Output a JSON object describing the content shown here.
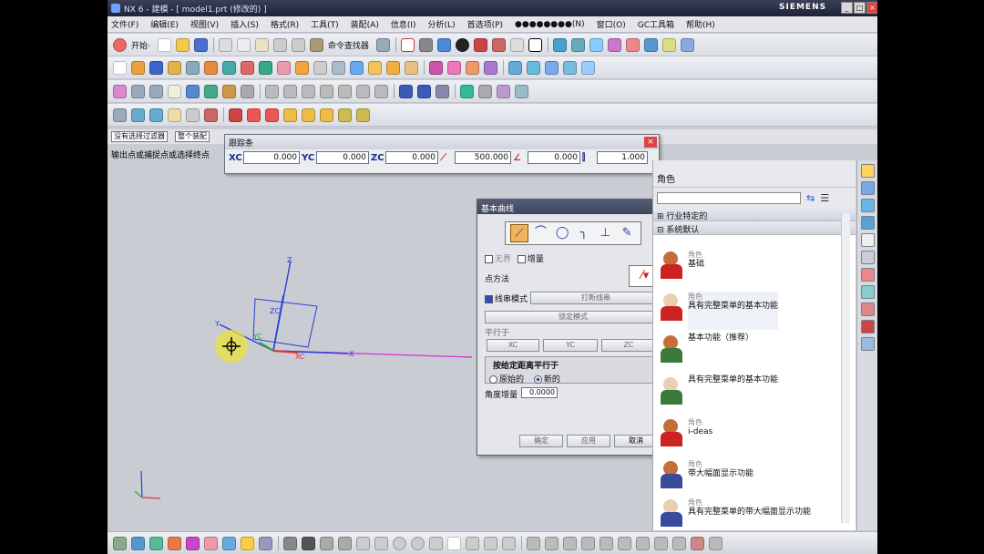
{
  "window": {
    "title": "NX 6 - 建模 - [ model1.prt (修改的) ]",
    "brand": "SIEMENS"
  },
  "menu": [
    "文件(F)",
    "编辑(E)",
    "视图(V)",
    "插入(S)",
    "格式(R)",
    "工具(T)",
    "装配(A)",
    "信息(I)",
    "分析(L)",
    "首选项(P)",
    "●●●●●●●●(N)",
    "窗口(O)",
    "GC工具箱",
    "帮助(H)"
  ],
  "toolbar": {
    "start_label": "开始·",
    "command_finder": "命令查找器"
  },
  "selection": {
    "filter": "没有选择过滤器",
    "scope": "整个装配"
  },
  "status": "输出点或捕捉点或选择终点",
  "trackbar": {
    "title": "跟踪条",
    "xc_label": "XC",
    "xc": "0.000",
    "yc_label": "YC",
    "yc": "0.000",
    "zc_label": "ZC",
    "zc": "0.000",
    "len": "500.000",
    "ang": "0.000",
    "extra": "1.000"
  },
  "dialog": {
    "title": "基本曲线",
    "infinite": "无界",
    "incremental": "增量",
    "point_method": "点方法",
    "string_mode": "线串模式",
    "break_string": "打断线串",
    "lock_mode": "锁定模式",
    "parallel_to": "平行于",
    "axes": [
      "XC",
      "YC",
      "ZC"
    ],
    "parallel_distance": "按给定距离平行于",
    "original": "原始的",
    "new": "新的",
    "angle_increment": "角度增量",
    "angle_value": "0.0000",
    "ok": "确定",
    "apply": "应用",
    "cancel": "取消"
  },
  "roles": {
    "title": "角色",
    "group1": "行业特定的",
    "group2": "系统默认",
    "items": [
      {
        "cat": "角色",
        "name": "基础"
      },
      {
        "cat": "角色",
        "name": "具有完整菜单的基本功能"
      },
      {
        "cat": "",
        "name": "基本功能（推荐）"
      },
      {
        "cat": "",
        "name": "具有完整菜单的基本功能"
      },
      {
        "cat": "角色",
        "name": "i-deas"
      },
      {
        "cat": "角色",
        "name": "带大幅面显示功能"
      },
      {
        "cat": "角色",
        "name": "具有完整菜单的带大幅面显示功能"
      }
    ]
  },
  "axes_labels": {
    "z": "Z",
    "x": "X",
    "y": "Y",
    "zc": "ZC",
    "xc": "XC",
    "yc": "YC"
  }
}
